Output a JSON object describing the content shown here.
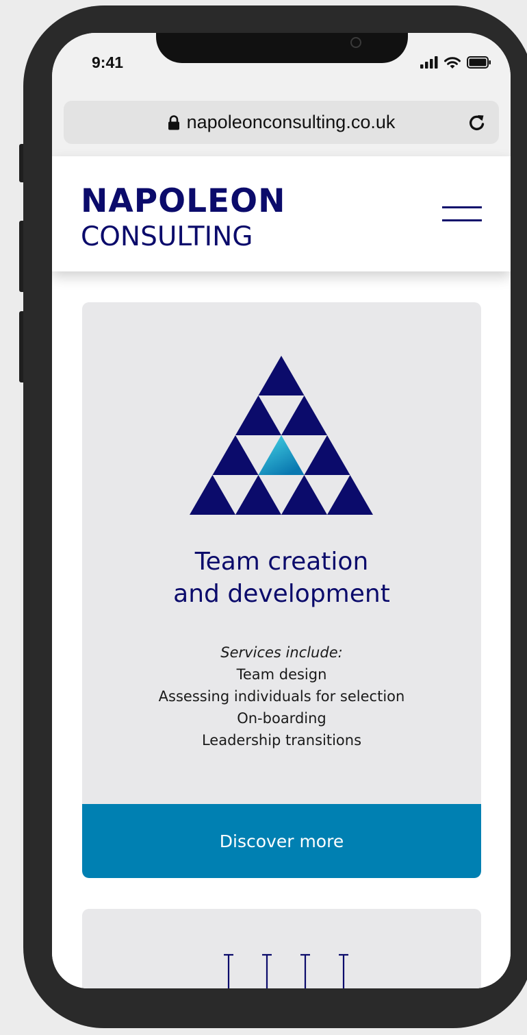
{
  "status_bar": {
    "time": "9:41"
  },
  "browser": {
    "url": "napoleonconsulting.co.uk"
  },
  "header": {
    "logo_line1": "NAPOLEON",
    "logo_line2": "CONSULTING"
  },
  "service_card": {
    "title_line1": "Team creation",
    "title_line2": "and development",
    "services_intro": "Services include:",
    "services": [
      "Team design",
      "Assessing individuals for selection",
      "On-boarding",
      "Leadership transitions"
    ],
    "button_label": "Discover more"
  },
  "colors": {
    "brand_navy": "#0b0b6b",
    "button_blue": "#0080b2",
    "accent_teal": "#2bb8cf",
    "card_bg": "#e8e8ea"
  },
  "icons": [
    "lock-icon",
    "signal-icon",
    "wifi-icon",
    "battery-icon",
    "reload-icon",
    "hamburger-menu-icon",
    "triangle-pyramid-icon",
    "pillars-icon"
  ]
}
